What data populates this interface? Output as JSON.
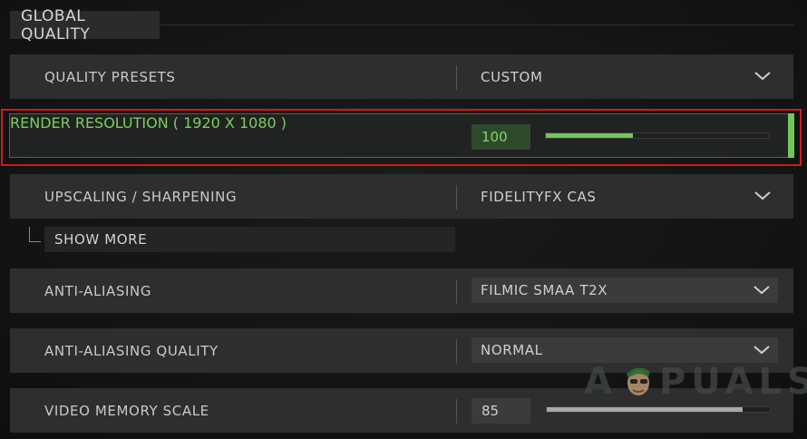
{
  "section": {
    "title": "GLOBAL QUALITY"
  },
  "rows": {
    "quality_presets": {
      "label": "QUALITY PRESETS",
      "value": "CUSTOM"
    },
    "render_resolution": {
      "label": "RENDER RESOLUTION ( 1920 X 1080 )",
      "value": "100",
      "slider_fraction": 0.39
    },
    "upscaling": {
      "label": "UPSCALING / SHARPENING",
      "value": "FIDELITYFX CAS"
    },
    "show_more": {
      "label": "SHOW MORE"
    },
    "anti_aliasing": {
      "label": "ANTI-ALIASING",
      "value": "FILMIC SMAA T2X"
    },
    "anti_aliasing_quality": {
      "label": "ANTI-ALIASING QUALITY",
      "value": "NORMAL"
    },
    "video_memory_scale": {
      "label": "VIDEO MEMORY SCALE",
      "value": "85",
      "slider_fraction": 0.88
    }
  },
  "watermark": {
    "text_left": "A",
    "text_right": "PUALS"
  },
  "colors": {
    "accent_green": "#71c65a",
    "label_green": "#7fcc5f",
    "highlight_red": "#d11a1a",
    "slider_gray": "#a8a8a8"
  },
  "icons": {
    "dropdown": "chevron-down-icon",
    "subitem": "bracket-icon"
  }
}
